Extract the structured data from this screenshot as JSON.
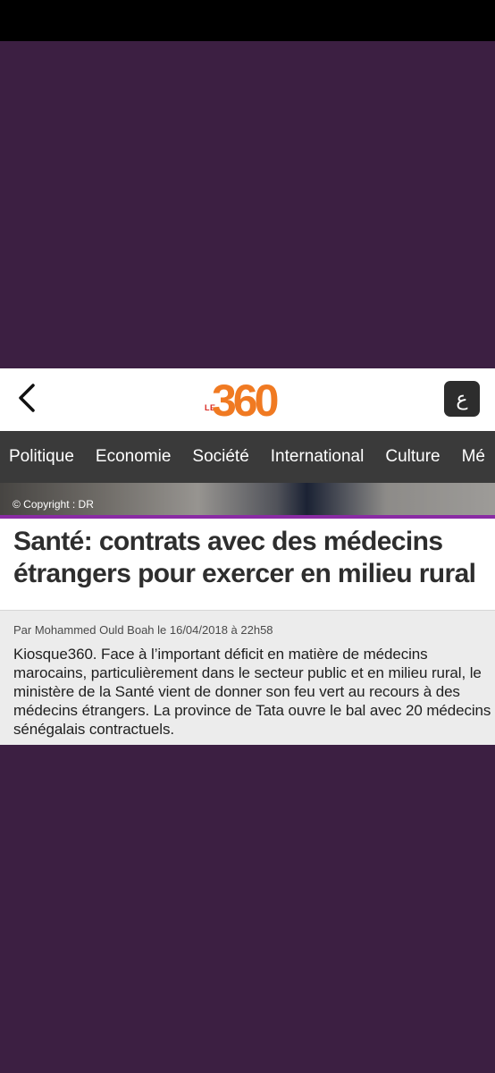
{
  "header": {
    "logo": {
      "prefix": "LE",
      "number": "360"
    },
    "language_button": "ع"
  },
  "nav": {
    "items": [
      "Politique",
      "Economie",
      "Société",
      "International",
      "Culture",
      "Mé"
    ]
  },
  "hero": {
    "copyright": "© Copyright : DR"
  },
  "article": {
    "title": "Santé: contrats avec des médecins étrangers pour exercer en milieu rural",
    "byline": "Par Mohammed Ould Boah le 16/04/2018 à 22h58",
    "lead": "Kiosque360. Face à l’important déficit en matière de médecins marocains, particulièrement dans le secteur public et en milieu rural, le ministère de la Santé vient de donner son feu vert au recours à des médecins étrangers. La province de Tata ouvre le bal avec 20 médecins sénégalais contractuels."
  },
  "colors": {
    "backdrop": "#3c1f42",
    "nav_background": "#3a3a3a",
    "accent_rule": "#8a2ba4",
    "logo_orange": "#f07a22",
    "logo_red": "#d8261e"
  },
  "icons": {
    "back": "chevron-left-icon",
    "language": "arabic-letter-icon"
  }
}
